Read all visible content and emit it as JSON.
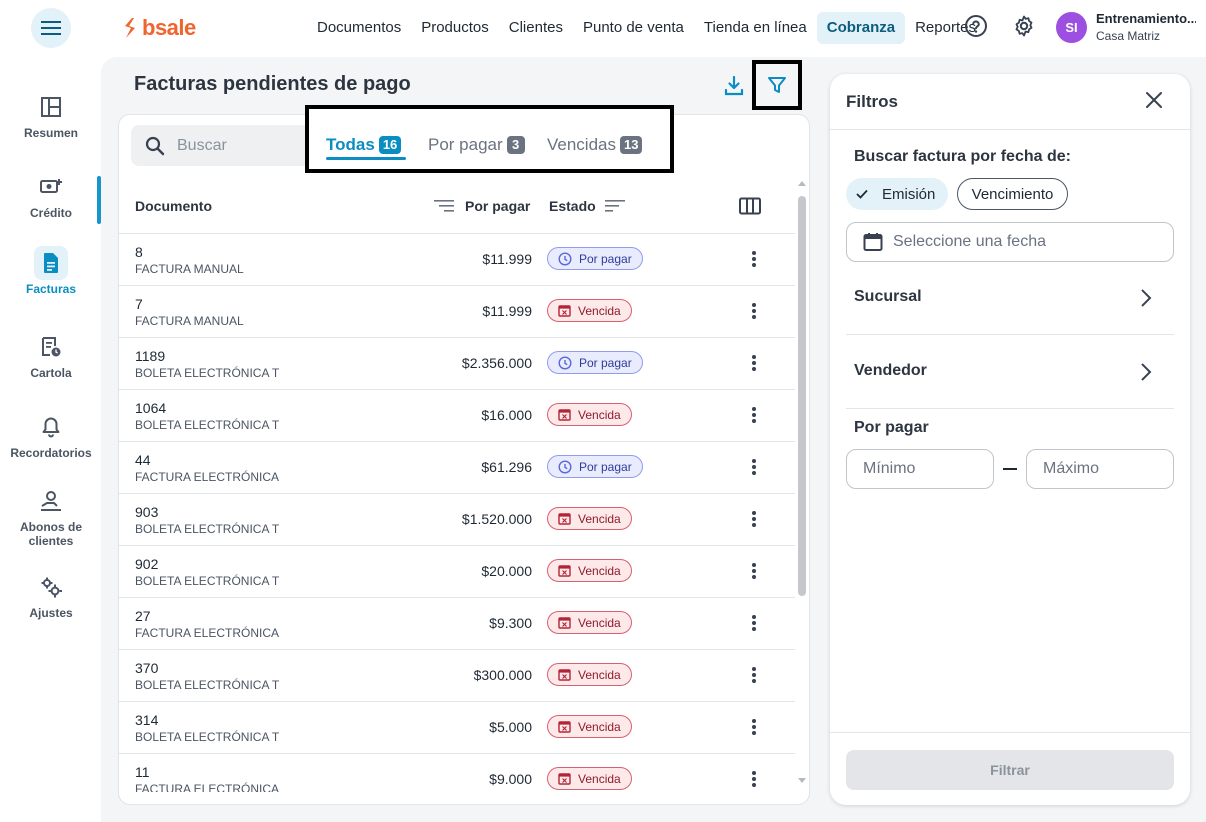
{
  "brand": {
    "name": "bsale",
    "accent": "#f0642d",
    "primary": "#0a8ec2"
  },
  "nav": {
    "items": [
      {
        "label": "Documentos"
      },
      {
        "label": "Productos"
      },
      {
        "label": "Clientes"
      },
      {
        "label": "Punto de venta"
      },
      {
        "label": "Tienda en línea"
      },
      {
        "label": "Cobranza",
        "active": true
      },
      {
        "label": "Reportes"
      }
    ],
    "help_icon": "help-circle-icon",
    "settings_icon": "gear-icon"
  },
  "user": {
    "initials": "SI",
    "name": "Entrenamiento...",
    "branch": "Casa Matriz"
  },
  "sidebar": {
    "items": [
      {
        "label": "Resumen",
        "icon": "layout-icon"
      },
      {
        "label": "Crédito",
        "icon": "money-add-icon"
      },
      {
        "label": "Facturas",
        "icon": "document-icon",
        "active": true
      },
      {
        "label": "Cartola",
        "icon": "statement-clock-icon"
      },
      {
        "label": "Recordatorios",
        "icon": "bell-icon"
      },
      {
        "label": "Abonos de clientes",
        "icon": "hand-coin-icon"
      },
      {
        "label": "Ajustes",
        "icon": "gears-icon"
      }
    ]
  },
  "page": {
    "title": "Facturas pendientes de pago"
  },
  "search": {
    "placeholder": "Buscar"
  },
  "tabs": [
    {
      "label": "Todas",
      "count": "16",
      "active": true
    },
    {
      "label": "Por pagar",
      "count": "3"
    },
    {
      "label": "Vencidas",
      "count": "13"
    }
  ],
  "table": {
    "columns": {
      "document": "Documento",
      "amount": "Por pagar",
      "status": "Estado"
    },
    "rows": [
      {
        "number": "8",
        "type": "FACTURA MANUAL",
        "amount": "$11.999",
        "status": "Por pagar",
        "kind": "pending"
      },
      {
        "number": "7",
        "type": "FACTURA MANUAL",
        "amount": "$11.999",
        "status": "Vencida",
        "kind": "overdue"
      },
      {
        "number": "1189",
        "type": "BOLETA ELECTRÓNICA T",
        "amount": "$2.356.000",
        "status": "Por pagar",
        "kind": "pending"
      },
      {
        "number": "1064",
        "type": "BOLETA ELECTRÓNICA T",
        "amount": "$16.000",
        "status": "Vencida",
        "kind": "overdue"
      },
      {
        "number": "44",
        "type": "FACTURA ELECTRÓNICA",
        "amount": "$61.296",
        "status": "Por pagar",
        "kind": "pending"
      },
      {
        "number": "903",
        "type": "BOLETA ELECTRÓNICA T",
        "amount": "$1.520.000",
        "status": "Vencida",
        "kind": "overdue"
      },
      {
        "number": "902",
        "type": "BOLETA ELECTRÓNICA T",
        "amount": "$20.000",
        "status": "Vencida",
        "kind": "overdue"
      },
      {
        "number": "27",
        "type": "FACTURA ELECTRÓNICA",
        "amount": "$9.300",
        "status": "Vencida",
        "kind": "overdue"
      },
      {
        "number": "370",
        "type": "BOLETA ELECTRÓNICA T",
        "amount": "$300.000",
        "status": "Vencida",
        "kind": "overdue"
      },
      {
        "number": "314",
        "type": "BOLETA ELECTRÓNICA T",
        "amount": "$5.000",
        "status": "Vencida",
        "kind": "overdue"
      },
      {
        "number": "11",
        "type": "FACTURA ELECTRÓNICA",
        "amount": "$9.000",
        "status": "Vencida",
        "kind": "overdue"
      }
    ]
  },
  "filters": {
    "title": "Filtros",
    "date_section": "Buscar factura por fecha de:",
    "date_options": {
      "emission": "Emisión",
      "due": "Vencimiento"
    },
    "date_placeholder": "Seleccione una fecha",
    "branch": "Sucursal",
    "seller": "Vendedor",
    "amount_section": "Por pagar",
    "min_placeholder": "Mínimo",
    "max_placeholder": "Máximo",
    "submit": "Filtrar"
  }
}
